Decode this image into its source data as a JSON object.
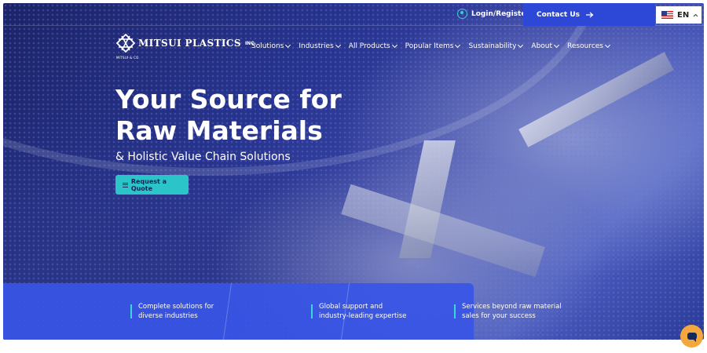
{
  "topbar": {
    "login_label": "Login/Register",
    "contact_label": "Contact Us",
    "language": "EN"
  },
  "brand": {
    "name": "MITSUI PLASTICS",
    "suffix": "INC.",
    "subtext": "MITSUI & CO."
  },
  "nav": {
    "items": [
      {
        "label": "Solutions"
      },
      {
        "label": "Industries"
      },
      {
        "label": "All Products"
      },
      {
        "label": "Popular Items"
      },
      {
        "label": "Sustainability"
      },
      {
        "label": "About"
      },
      {
        "label": "Resources"
      }
    ]
  },
  "hero": {
    "line1": "Your Source for",
    "line2": "Raw Materials",
    "tagline": "& Holistic Value Chain Solutions",
    "cta_label": "Request a Quote"
  },
  "features": [
    {
      "text": "Complete solutions for diverse industries"
    },
    {
      "text": "Global support and industry-leading expertise"
    },
    {
      "text": "Services beyond raw material sales for your success"
    }
  ],
  "colors": {
    "accent": "#2bc4c8",
    "primary": "#2d47d6",
    "chat": "#f3a73c"
  },
  "icons": [
    "user-icon",
    "arrow-right-icon",
    "us-flag-icon",
    "chevron-up-icon",
    "chevron-down-icon",
    "menu-icon",
    "chat-icon"
  ]
}
